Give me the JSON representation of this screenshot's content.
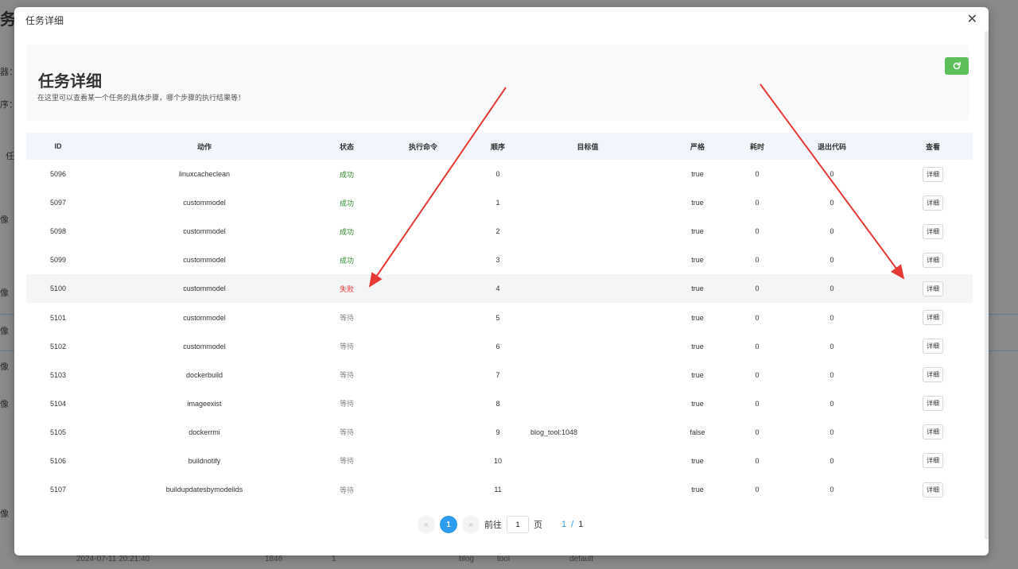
{
  "background": {
    "title_fragment": "务纟",
    "side_labels": [
      "器：",
      "序：",
      "任",
      "像",
      "像",
      "像",
      "像",
      "像",
      "像"
    ],
    "bottom_row": {
      "time": "2024-07-11 20:21:40",
      "num": "1846",
      "one": "1",
      "blog": "blog",
      "tool": "tool",
      "default": "default"
    }
  },
  "dialog": {
    "title": "任务详细",
    "close_icon": "close-icon"
  },
  "hero": {
    "title": "任务详细",
    "subtitle": "在这里可以查看某一个任务的具体步骤，哪个步骤的执行结果等！",
    "refresh_icon": "refresh-icon",
    "refresh_color": "#5cbf5a"
  },
  "table": {
    "headers": [
      "ID",
      "动作",
      "状态",
      "执行命令",
      "顺序",
      "目标值",
      "严格",
      "耗时",
      "退出代码",
      "查看"
    ],
    "rows": [
      {
        "id": "5096",
        "action": "linuxcacheclean",
        "status": "成功",
        "status_kind": "success",
        "cmd": "",
        "order": "0",
        "target": "",
        "strict": "true",
        "time": "0",
        "exit": "0",
        "view": "详细"
      },
      {
        "id": "5097",
        "action": "custommodel",
        "status": "成功",
        "status_kind": "success",
        "cmd": "",
        "order": "1",
        "target": "",
        "strict": "true",
        "time": "0",
        "exit": "0",
        "view": "详细"
      },
      {
        "id": "5098",
        "action": "custommodel",
        "status": "成功",
        "status_kind": "success",
        "cmd": "",
        "order": "2",
        "target": "",
        "strict": "true",
        "time": "0",
        "exit": "0",
        "view": "详细"
      },
      {
        "id": "5099",
        "action": "custommodel",
        "status": "成功",
        "status_kind": "success",
        "cmd": "",
        "order": "3",
        "target": "",
        "strict": "true",
        "time": "0",
        "exit": "0",
        "view": "详细"
      },
      {
        "id": "5100",
        "action": "custommodel",
        "status": "失败",
        "status_kind": "fail",
        "cmd": "",
        "order": "4",
        "target": "",
        "strict": "true",
        "time": "0",
        "exit": "0",
        "view": "详细"
      },
      {
        "id": "5101",
        "action": "custommodel",
        "status": "等待",
        "status_kind": "wait",
        "cmd": "",
        "order": "5",
        "target": "",
        "strict": "true",
        "time": "0",
        "exit": "0",
        "view": "详细"
      },
      {
        "id": "5102",
        "action": "custommodel",
        "status": "等待",
        "status_kind": "wait",
        "cmd": "",
        "order": "6",
        "target": "",
        "strict": "true",
        "time": "0",
        "exit": "0",
        "view": "详细"
      },
      {
        "id": "5103",
        "action": "dockerbuild",
        "status": "等待",
        "status_kind": "wait",
        "cmd": "",
        "order": "7",
        "target": "",
        "strict": "true",
        "time": "0",
        "exit": "0",
        "view": "详细"
      },
      {
        "id": "5104",
        "action": "imageexist",
        "status": "等待",
        "status_kind": "wait",
        "cmd": "",
        "order": "8",
        "target": "",
        "strict": "true",
        "time": "0",
        "exit": "0",
        "view": "详细"
      },
      {
        "id": "5105",
        "action": "dockerrmi",
        "status": "等待",
        "status_kind": "wait",
        "cmd": "",
        "order": "9",
        "target": "blog_tool:1048",
        "strict": "false",
        "time": "0",
        "exit": "0",
        "view": "详细"
      },
      {
        "id": "5106",
        "action": "buildnotify",
        "status": "等待",
        "status_kind": "wait",
        "cmd": "",
        "order": "10",
        "target": "",
        "strict": "true",
        "time": "0",
        "exit": "0",
        "view": "详细"
      },
      {
        "id": "5107",
        "action": "buildupdatesbymodelids",
        "status": "等待",
        "status_kind": "wait",
        "cmd": "",
        "order": "11",
        "target": "",
        "strict": "true",
        "time": "0",
        "exit": "0",
        "view": "详细"
      }
    ],
    "highlighted_row_id": "5100",
    "status_colors": {
      "success": "#2e8b2e",
      "fail": "#ee3333",
      "wait": "#888888"
    }
  },
  "pagination": {
    "prev": "«",
    "current": "1",
    "next": "»",
    "goto_label": "前往",
    "goto_value": "1",
    "page_label": "页",
    "current_page": "1",
    "separator": "/",
    "total_pages": "1",
    "accent": "#2d9bf0"
  },
  "annotation": {
    "arrow_color": "#e53935"
  }
}
